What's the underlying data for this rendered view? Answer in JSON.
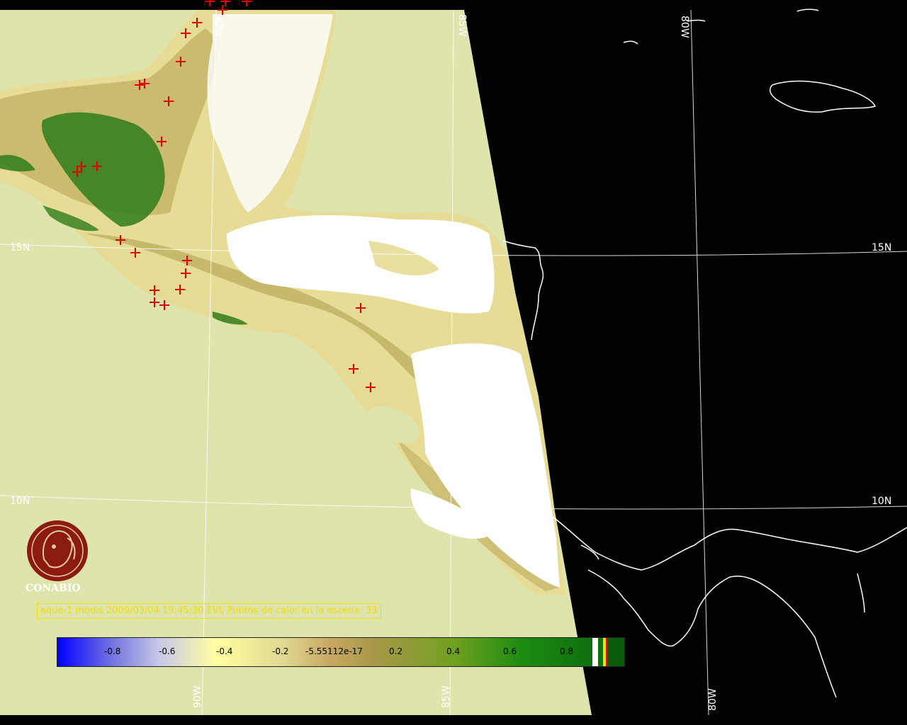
{
  "caption": "aqua-1 modis 2009/03/04 19:45:30 EVI, Puntos de calor en la escena: 33",
  "logo": {
    "name": "CONABIO"
  },
  "grid_labels": {
    "lat_15n_left": "15N",
    "lat_15n_right": "15N",
    "lat_10n_left": "10N",
    "lat_10n_right": "10N",
    "lon_90w_top": "90W",
    "lon_85w_top": "85W",
    "lon_80w_top": "80W",
    "lon_90w_bottom": "90W",
    "lon_85w_bottom": "85W",
    "lon_80w_bottom": "80W"
  },
  "colorbar": {
    "ticks": [
      "-0.8",
      "-0.6",
      "-0.4",
      "-0.2",
      "-5.55112e-17",
      "0.2",
      "0.4",
      "0.6",
      "0.8"
    ]
  },
  "colors": {
    "sea": "#dfe4ac",
    "land_light": "#e6dc96",
    "land_mid": "#b3a150",
    "forest": "#2f7d1a",
    "cloud": "#ffffff",
    "night": "#000000",
    "hotspot": "#e00000",
    "caption": "#f0e000"
  }
}
